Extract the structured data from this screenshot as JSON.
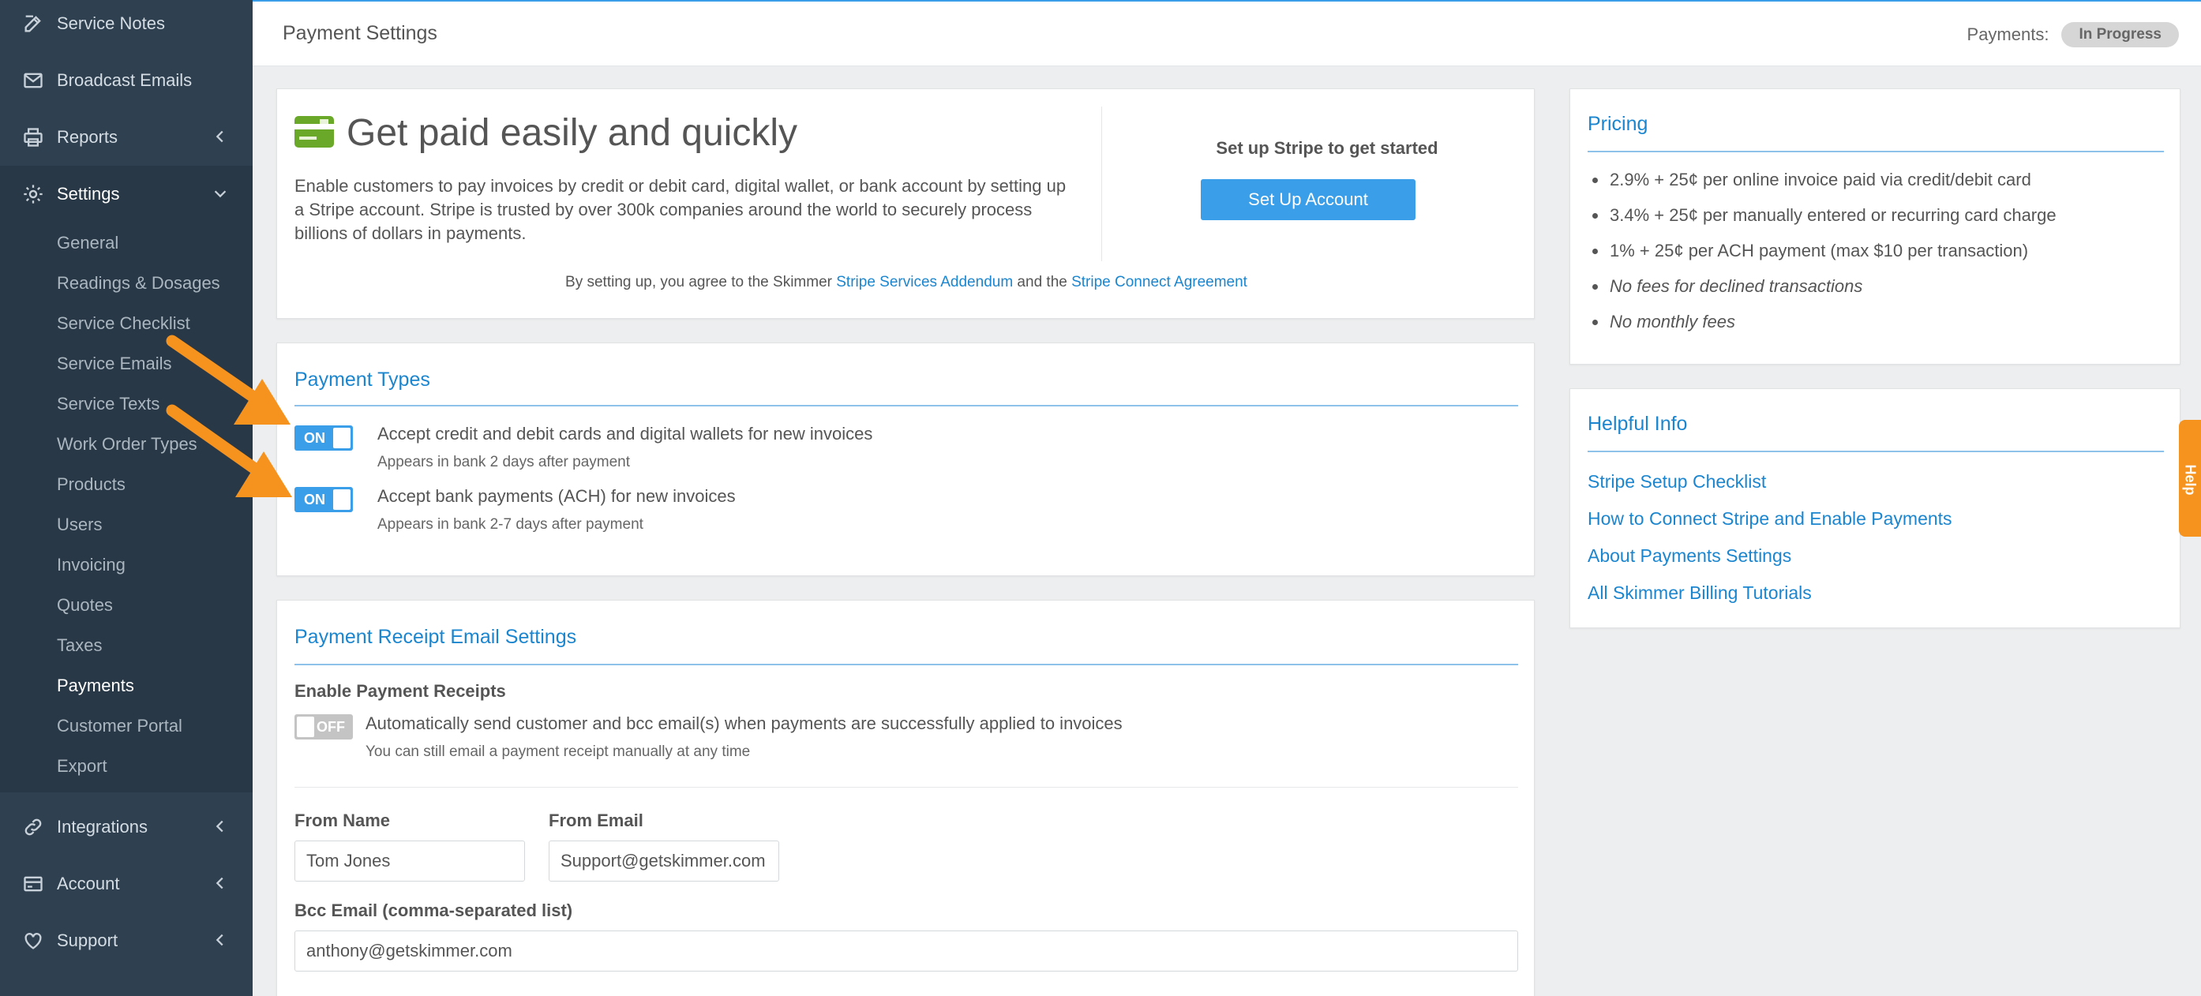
{
  "sidebar": {
    "items": [
      {
        "label": "Service Notes",
        "icon": "edit-icon"
      },
      {
        "label": "Broadcast Emails",
        "icon": "envelope-icon"
      },
      {
        "label": "Reports",
        "icon": "printer-icon"
      },
      {
        "label": "Settings",
        "icon": "gear-icon"
      },
      {
        "label": "Integrations",
        "icon": "link-icon"
      },
      {
        "label": "Account",
        "icon": "credit-card-icon"
      },
      {
        "label": "Support",
        "icon": "heart-icon"
      }
    ],
    "settings_sub": [
      "General",
      "Readings & Dosages",
      "Service Checklist",
      "Service Emails",
      "Service Texts",
      "Work Order Types",
      "Products",
      "Users",
      "Invoicing",
      "Quotes",
      "Taxes",
      "Payments",
      "Customer Portal",
      "Export"
    ]
  },
  "header": {
    "title": "Payment Settings",
    "payments_label": "Payments:",
    "payments_status": "In Progress"
  },
  "hero": {
    "heading": "Get paid easily and quickly",
    "description": "Enable customers to pay invoices by credit or debit card, digital wallet, or bank account by setting up a Stripe account. Stripe is trusted by over 300k companies around the world to securely process billions of dollars in payments.",
    "cta_text": "Set up Stripe to get started",
    "button_label": "Set Up Account",
    "agree_prefix": "By setting up, you agree to the Skimmer ",
    "agree_link1": "Stripe Services Addendum",
    "agree_mid": " and the ",
    "agree_link2": "Stripe Connect Agreement"
  },
  "payment_types": {
    "title": "Payment Types",
    "options": [
      {
        "state": "ON",
        "label": "Accept credit and debit cards and digital wallets for new invoices",
        "sub": "Appears in bank 2 days after payment"
      },
      {
        "state": "ON",
        "label": "Accept bank payments (ACH) for new invoices",
        "sub": "Appears in bank 2-7 days after payment"
      }
    ]
  },
  "receipt": {
    "title": "Payment Receipt Email Settings",
    "enable_label": "Enable Payment Receipts",
    "toggle_state": "OFF",
    "toggle_text": "Automatically send customer and bcc email(s) when payments are successfully applied to invoices",
    "toggle_sub": "You can still email a payment receipt manually at any time",
    "from_name_label": "From Name",
    "from_name_value": "Tom Jones",
    "from_email_label": "From Email",
    "from_email_value": "Support@getskimmer.com",
    "bcc_label": "Bcc Email (comma-separated list)",
    "bcc_value": "anthony@getskimmer.com"
  },
  "pricing": {
    "title": "Pricing",
    "items": [
      "2.9% + 25¢ per online invoice paid via credit/debit card",
      "3.4% + 25¢ per manually entered or recurring card charge",
      "1% + 25¢ per ACH payment (max $10 per transaction)",
      "No fees for declined transactions",
      "No monthly fees"
    ]
  },
  "helpful": {
    "title": "Helpful Info",
    "links": [
      "Stripe Setup Checklist",
      "How to Connect Stripe and Enable Payments",
      "About Payments Settings",
      "All Skimmer Billing Tutorials"
    ]
  },
  "help_tab": "Help",
  "colors": {
    "sidebar": "#2f4050",
    "accent": "#3a9ee8",
    "link": "#1b86cf",
    "annotation_arrow": "#f6921e"
  }
}
